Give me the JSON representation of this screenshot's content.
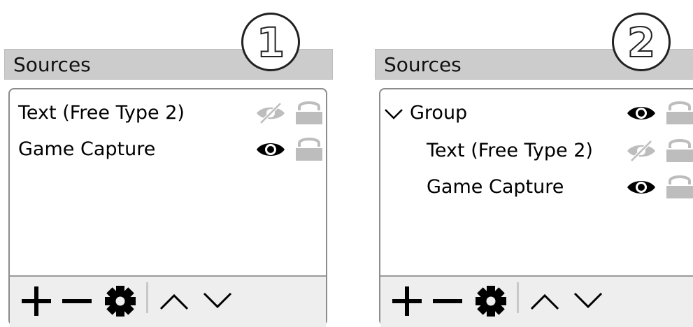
{
  "panels": [
    {
      "badge": "1",
      "title": "Sources",
      "items": [
        {
          "label": "Text (Free Type 2)",
          "visible": false,
          "locked": false
        },
        {
          "label": "Game Capture",
          "visible": true,
          "locked": false
        }
      ]
    },
    {
      "badge": "2",
      "title": "Sources",
      "group": {
        "label": "Group",
        "expanded": true,
        "visible": true,
        "locked": false
      },
      "items": [
        {
          "label": "Text (Free Type 2)",
          "visible": false,
          "locked": false
        },
        {
          "label": "Game Capture",
          "visible": true,
          "locked": false
        }
      ]
    }
  ],
  "toolbar": {
    "buttons": [
      "plus-icon",
      "minus-icon",
      "gear-icon",
      "chevron-up-icon",
      "chevron-down-icon"
    ]
  },
  "colors": {
    "header_bg": "#cccccc",
    "toolbar_bg": "#eeeeee",
    "list_border": "#8c8c8c",
    "icon_dark": "#000000",
    "icon_muted": "#bdbdbd"
  }
}
